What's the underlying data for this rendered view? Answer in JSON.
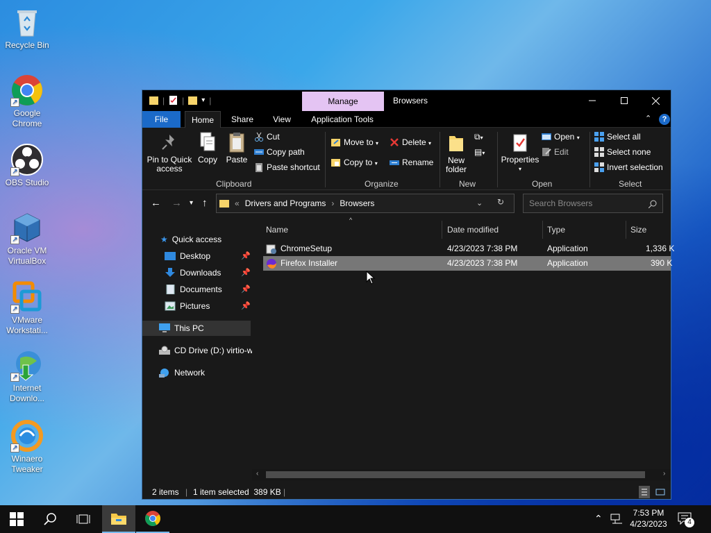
{
  "desktop": {
    "icons": [
      {
        "label": "Recycle Bin"
      },
      {
        "label": "Google Chrome"
      },
      {
        "label": "OBS Studio"
      },
      {
        "label": "Oracle VM VirtualBox"
      },
      {
        "label": "VMware Workstati..."
      },
      {
        "label": "Internet Downlo..."
      },
      {
        "label": "Winaero Tweaker"
      }
    ]
  },
  "window": {
    "contextual_tab": "Manage",
    "title": "Browsers",
    "ribbon_tabs": {
      "file": "File",
      "home": "Home",
      "share": "Share",
      "view": "View",
      "app_tools": "Application Tools"
    },
    "ribbon": {
      "pin": "Pin to Quick access",
      "copy": "Copy",
      "paste": "Paste",
      "cut": "Cut",
      "copy_path": "Copy path",
      "paste_shortcut": "Paste shortcut",
      "move_to": "Move to",
      "copy_to": "Copy to",
      "delete": "Delete",
      "rename": "Rename",
      "new_folder": "New folder",
      "properties": "Properties",
      "open": "Open",
      "edit": "Edit",
      "select_all": "Select all",
      "select_none": "Select none",
      "invert_selection": "Invert selection",
      "groups": {
        "clipboard": "Clipboard",
        "organize": "Organize",
        "new": "New",
        "open": "Open",
        "select": "Select"
      }
    },
    "address": {
      "crumbs": [
        "Drivers and Programs",
        "Browsers"
      ],
      "search_placeholder": "Search Browsers"
    },
    "nav": {
      "quick_access": "Quick access",
      "desktop": "Desktop",
      "downloads": "Downloads",
      "documents": "Documents",
      "pictures": "Pictures",
      "this_pc": "This PC",
      "cd_drive": "CD Drive (D:) virtio-w",
      "network": "Network"
    },
    "columns": {
      "name": "Name",
      "date": "Date modified",
      "type": "Type",
      "size": "Size"
    },
    "files": [
      {
        "name": "ChromeSetup",
        "date": "4/23/2023 7:38 PM",
        "type": "Application",
        "size": "1,336 K"
      },
      {
        "name": "Firefox Installer",
        "date": "4/23/2023 7:38 PM",
        "type": "Application",
        "size": "390 K"
      }
    ],
    "status": {
      "items": "2 items",
      "selected": "1 item selected  389 KB"
    }
  },
  "taskbar": {
    "time": "7:53 PM",
    "date": "4/23/2023",
    "notifications": "4"
  },
  "colors": {
    "accent": "#1b6ac9",
    "manage_tab": "#e4c4f3",
    "selection": "#777777"
  }
}
